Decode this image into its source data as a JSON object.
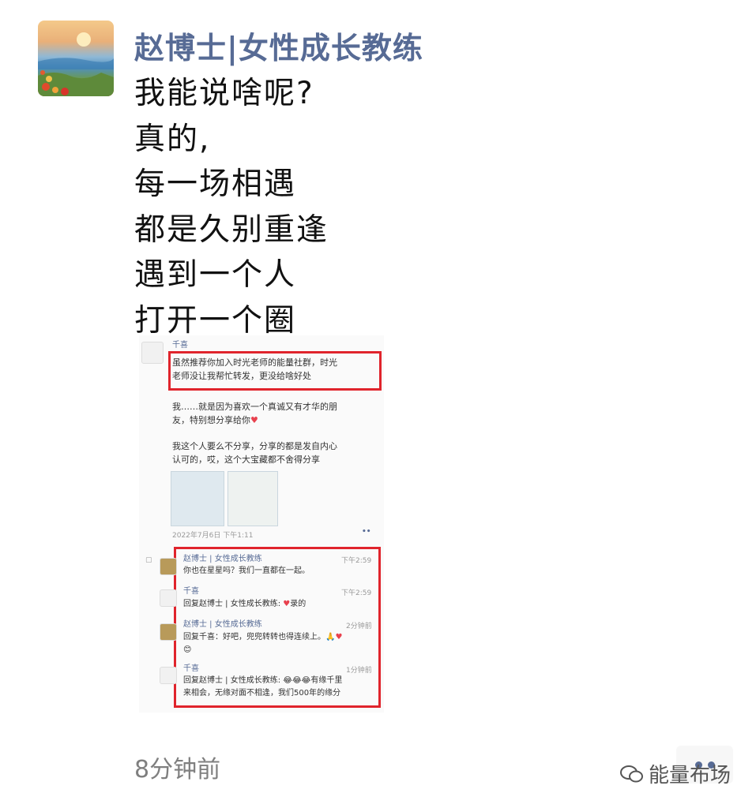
{
  "post": {
    "author": "赵博士|女性成长教练",
    "lines": [
      "我能说啥呢?",
      "真的,",
      "每一场相遇",
      "都是久别重逢",
      "遇到一个人",
      "打开一个圈"
    ],
    "timestamp": "8分钟前"
  },
  "screenshot": {
    "sender": "千喜",
    "highlight_line1": "虽然推荐你加入时光老师的能量社群，时光",
    "highlight_line2": "老师没让我帮忙转发，更没给啥好处",
    "para1_line1": "我……就是因为喜欢一个真诚又有才华的朋",
    "para1_line2": "友，特别想分享给你",
    "para2_line1": "我这个人要么不分享，分享的都是发自内心",
    "para2_line2": "认可的，哎，这个大宝藏都不舍得分享",
    "date": "2022年7月6日 下午1:11",
    "comments": [
      {
        "name": "赵博士 | 女性成长教练",
        "time": "下午2:59",
        "text": "你也在星星吗？我们一直都在一起。"
      },
      {
        "name": "千喜",
        "time": "下午2:59",
        "text": "回复赵博士 | 女性成长教练: ",
        "text2": "录的"
      },
      {
        "name": "赵博士 | 女性成长教练",
        "time": "2分钟前",
        "text": "回复千喜：好吧，兜兜转转也得连续上。"
      },
      {
        "name": "千喜",
        "time": "1分钟前",
        "text": "回复赵博士 | 女性成长教练: ",
        "text2": "有缘千里",
        "text3": "来相会，无缘对面不相逢，我们500年的缘分"
      }
    ]
  },
  "watermark": "能量布场",
  "colors": {
    "link": "#576b95",
    "highlight_border": "#e0242c",
    "timestamp": "#7f7f7f"
  }
}
